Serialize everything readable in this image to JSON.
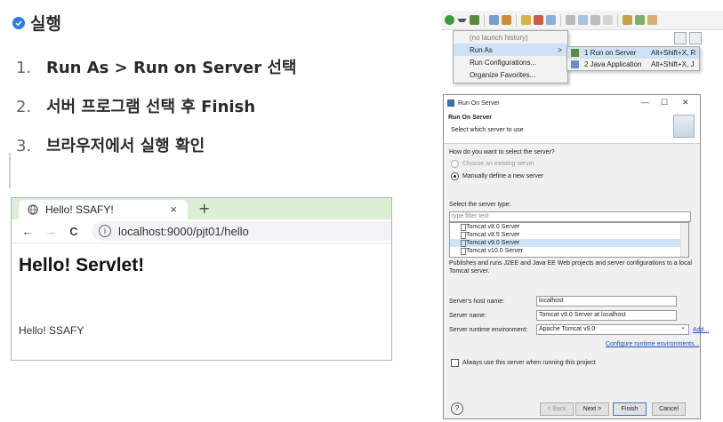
{
  "slide": {
    "heading": "실행",
    "steps": [
      {
        "num": "1.",
        "text": "Run As > Run on Server 선택"
      },
      {
        "num": "2.",
        "text": "서버 프로그램 선택 후 Finish"
      },
      {
        "num": "3.",
        "text": "브라우저에서 실행 확인"
      }
    ]
  },
  "browser": {
    "tab_title": "Hello! SSAFY!",
    "tab_close": "×",
    "new_tab": "+",
    "back": "←",
    "forward": "→",
    "reload": "C",
    "info": "i",
    "url": "localhost:9000/pjt01/hello",
    "page_heading": "Hello! Servlet!",
    "page_text": "Hello! SSAFY"
  },
  "menu": {
    "items": [
      {
        "label": "(no launch history)",
        "arrow": ""
      },
      {
        "label": "Run As",
        "arrow": ">"
      },
      {
        "label": "Run Configurations...",
        "arrow": ""
      },
      {
        "label": "Organize Favorites...",
        "arrow": ""
      }
    ],
    "submenu": [
      {
        "label": "1 Run on Server",
        "shortcut": "Alt+Shift+X, R"
      },
      {
        "label": "2 Java Application",
        "shortcut": "Alt+Shift+X, J"
      }
    ]
  },
  "dialog": {
    "window_title": "Run On Server",
    "minimize": "—",
    "maximize": "☐",
    "close": "✕",
    "header_title": "Run On Server",
    "header_subtitle": "Select which server to use",
    "question": "How do you want to select the server?",
    "option_existing": "Choose an existing server",
    "option_manual": "Manually define a new server",
    "server_type_label": "Select the server type:",
    "filter_placeholder": "type filter text",
    "server_types": [
      "Tomcat v8.0 Server",
      "Tomcat v8.5 Server",
      "Tomcat v9.0 Server",
      "Tomcat v10.0 Server"
    ],
    "description": "Publishes and runs J2EE and Java EE Web projects and server configurations to a local Tomcat server.",
    "host_label": "Server's host name:",
    "host_value": "localhost",
    "name_label": "Server name:",
    "name_value": "Tomcat v9.0 Server at localhost",
    "runtime_label": "Server runtime environment:",
    "runtime_value": "Apache Tomcat v9.0",
    "add_link": "Add...",
    "configure_link": "Configure runtime environments...",
    "always_use": "Always use this server when running this project",
    "help": "?",
    "back_btn": "< Back",
    "next_btn": "Next >",
    "finish_btn": "Finish",
    "cancel_btn": "Cancel"
  }
}
